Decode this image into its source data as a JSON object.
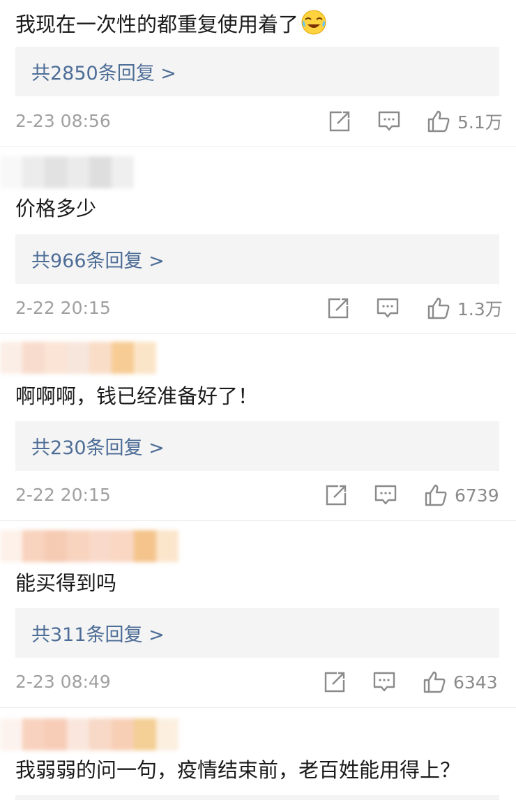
{
  "comments": [
    {
      "text": "我现在一次性的都重复使用着了",
      "emoji": "crying-laughing-emoji",
      "replies": "共2850条回复 >",
      "time": "2-23 08:56",
      "likes": "5.1万"
    },
    {
      "text": "价格多少",
      "replies": "共966条回复 >",
      "time": "2-22 20:15",
      "likes": "1.3万"
    },
    {
      "text": "啊啊啊，钱已经准备好了！",
      "replies": "共230条回复 >",
      "time": "2-22 20:15",
      "likes": "6739"
    },
    {
      "text": "能买得到吗",
      "replies": "共311条回复 >",
      "time": "2-23 08:49",
      "likes": "6343"
    },
    {
      "text": "我弱弱的问一句，疫情结束前，老百姓能用得上？"
    }
  ],
  "icons": {
    "share": "share-icon",
    "comment": "comment-icon",
    "like": "thumbs-up-icon"
  },
  "colors": {
    "reply_link": "#4d6d96",
    "reply_bg": "#f4f4f4",
    "timestamp": "#a0a0a0",
    "icon": "#8a8a8a"
  }
}
